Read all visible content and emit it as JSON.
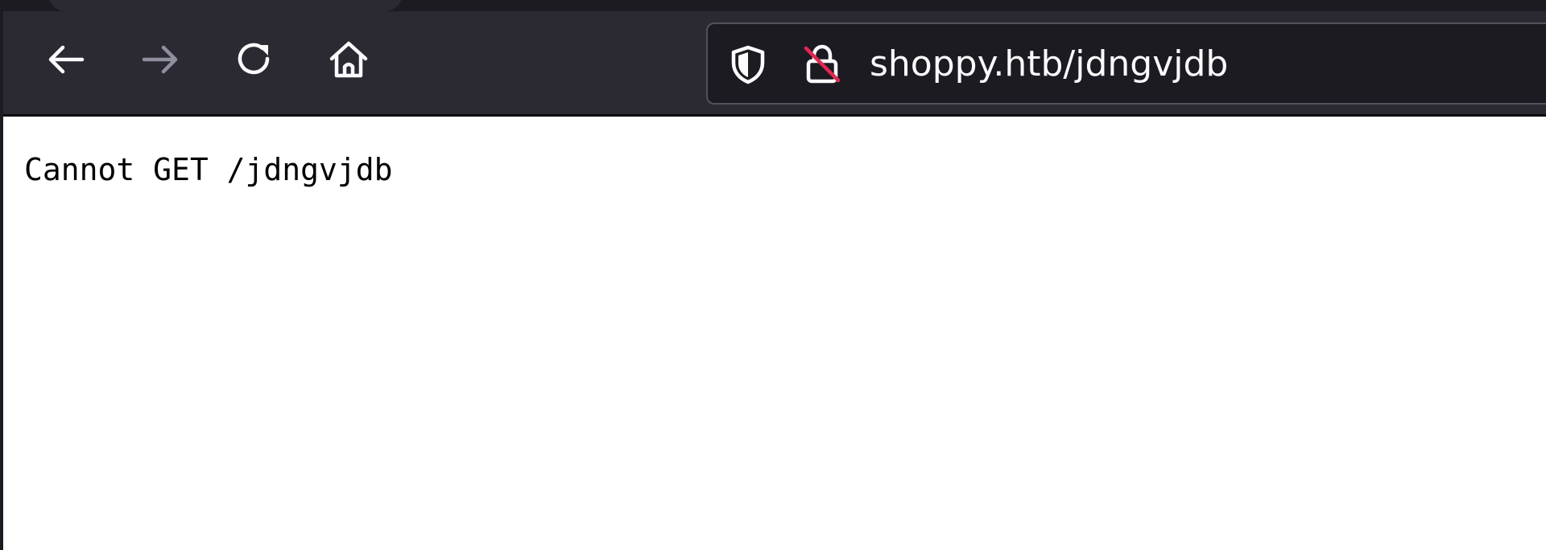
{
  "browser": {
    "toolbar": {
      "back_icon": "arrow-left-icon",
      "forward_icon": "arrow-right-icon",
      "forward_enabled": false,
      "reload_icon": "reload-icon",
      "home_icon": "home-icon"
    },
    "url_bar": {
      "tracking_protection_icon": "shield-icon",
      "connection_icon": "insecure-lock-icon",
      "url": "shoppy.htb/jdngvjdb"
    }
  },
  "page": {
    "body_text": "Cannot GET /jdngvjdb"
  },
  "colors": {
    "toolbar_bg": "#2b2a33",
    "urlbar_bg": "#1c1b22",
    "icon_color": "#fbfbfe",
    "icon_disabled": "#8f8f9d",
    "insecure_slash": "#e22850",
    "page_bg": "#ffffff",
    "page_text": "#000000"
  }
}
